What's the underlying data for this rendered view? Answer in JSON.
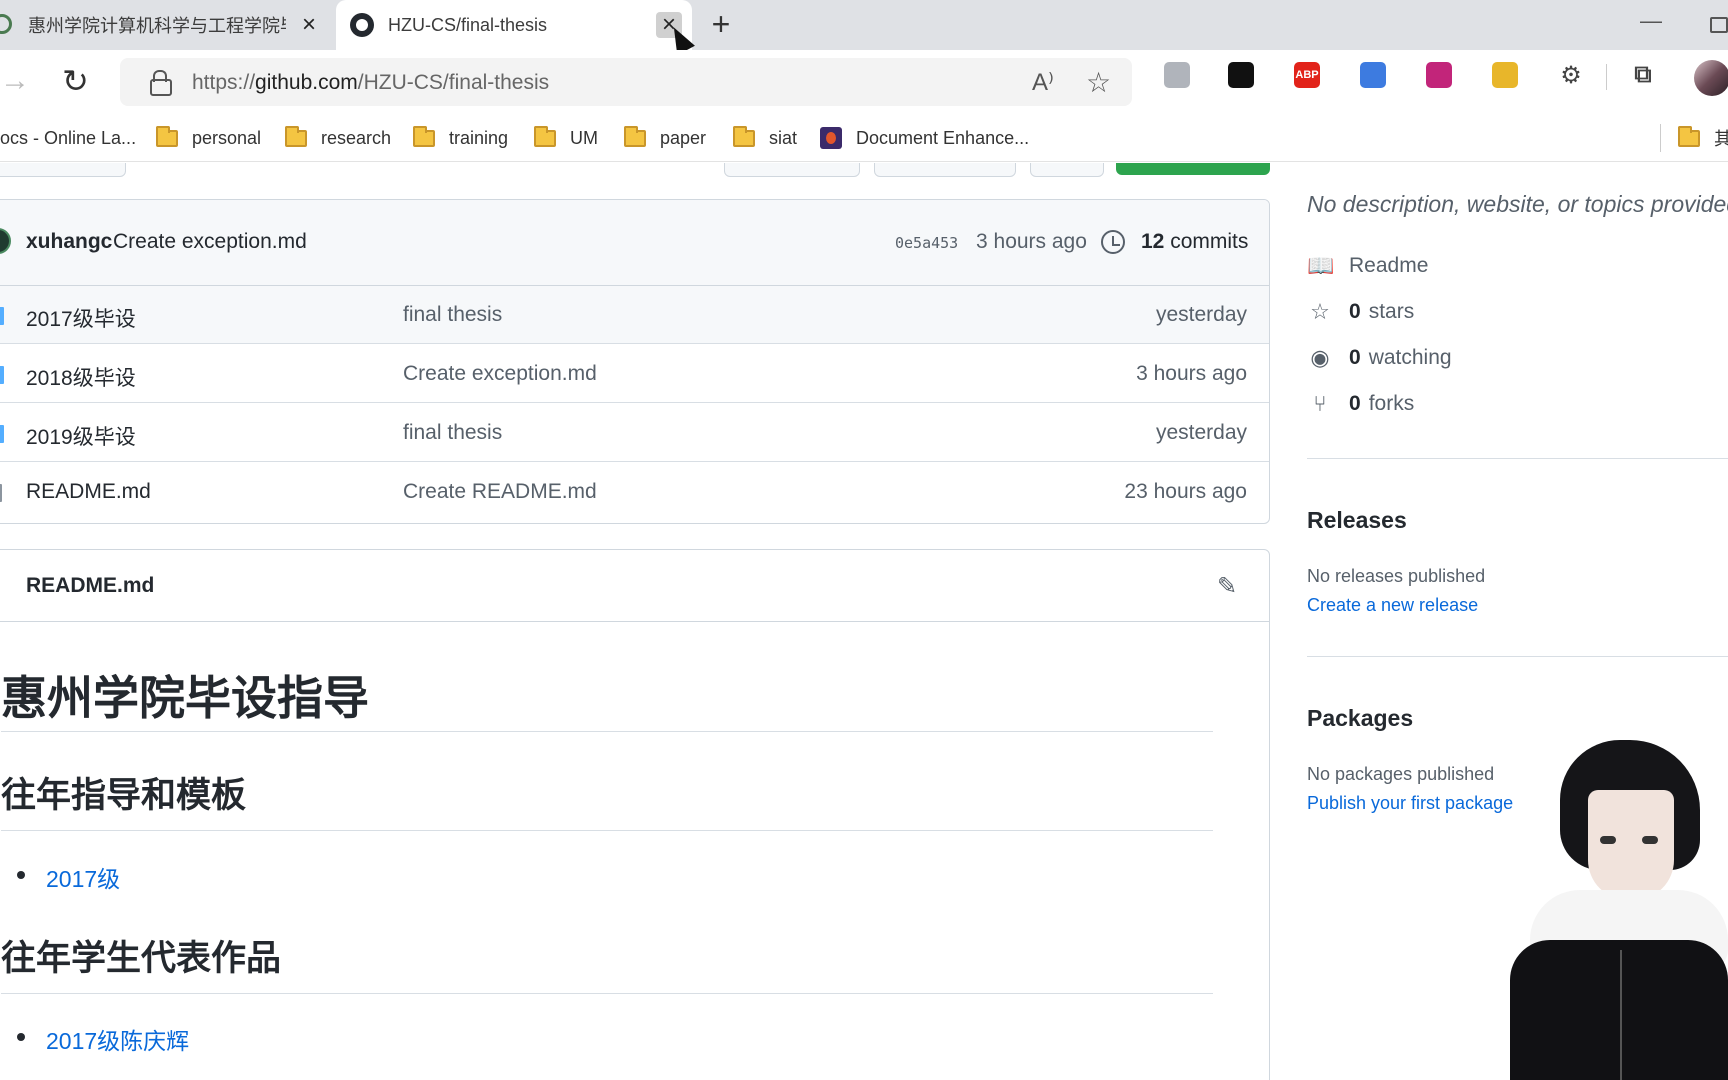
{
  "browser": {
    "tabs": [
      {
        "title": "惠州学院计算机科学与工程学院毕"
      },
      {
        "title": "HZU-CS/final-thesis"
      }
    ],
    "url_prefix": "https://",
    "url_host": "github.com",
    "url_path": "/HZU-CS/final-thesis",
    "bookmarks": [
      {
        "label": "ocs - Online La...",
        "icon": "page-icon"
      },
      {
        "label": "personal",
        "icon": "folder-icon"
      },
      {
        "label": "research",
        "icon": "folder-icon"
      },
      {
        "label": "training",
        "icon": "folder-icon"
      },
      {
        "label": "UM",
        "icon": "folder-icon"
      },
      {
        "label": "paper",
        "icon": "folder-icon"
      },
      {
        "label": "siat",
        "icon": "folder-icon"
      },
      {
        "label": "Document Enhance...",
        "icon": "app-icon"
      },
      {
        "label": "其",
        "icon": "folder-icon"
      }
    ],
    "extensions": [
      {
        "name": "bird-extension-icon",
        "color": "#b0b4bb",
        "text": ""
      },
      {
        "name": "dark-extension-icon",
        "color": "#111111",
        "text": ""
      },
      {
        "name": "adblock-plus-icon",
        "color": "#e2231a",
        "text": "ABP"
      },
      {
        "name": "blue-cube-extension-icon",
        "color": "#3d7be0",
        "text": ""
      },
      {
        "name": "colorful-extension-icon",
        "color": "#c2257a",
        "text": ""
      },
      {
        "name": "tampermonkey-icon",
        "color": "#e8b62a",
        "text": ""
      }
    ]
  },
  "commit": {
    "author": "xuhangc",
    "message": "Create exception.md",
    "sha": "0e5a453",
    "time": "3 hours ago",
    "count": "12",
    "count_label": "commits"
  },
  "files": [
    {
      "name": "2017级毕设",
      "message": "final thesis",
      "time": "yesterday",
      "type": "dir"
    },
    {
      "name": "2018级毕设",
      "message": "Create exception.md",
      "time": "3 hours ago",
      "type": "dir"
    },
    {
      "name": "2019级毕设",
      "message": "final thesis",
      "time": "yesterday",
      "type": "dir"
    },
    {
      "name": "README.md",
      "message": "Create README.md",
      "time": "23 hours ago",
      "type": "file"
    }
  ],
  "readme": {
    "title": "README.md",
    "h1": "惠州学院毕设指导",
    "section1": "往年指导和模板",
    "section1_items": [
      "2017级"
    ],
    "section2": "往年学生代表作品",
    "section2_items": [
      "2017级陈庆辉"
    ]
  },
  "sidebar": {
    "description": "No description, website, or topics provided.",
    "readme_label": "Readme",
    "stars": "0",
    "stars_label": "stars",
    "watching": "0",
    "watching_label": "watching",
    "forks": "0",
    "forks_label": "forks",
    "releases_title": "Releases",
    "releases_empty": "No releases published",
    "releases_link": "Create a new release",
    "packages_title": "Packages",
    "packages_empty": "No packages published",
    "packages_link": "Publish your first package"
  }
}
